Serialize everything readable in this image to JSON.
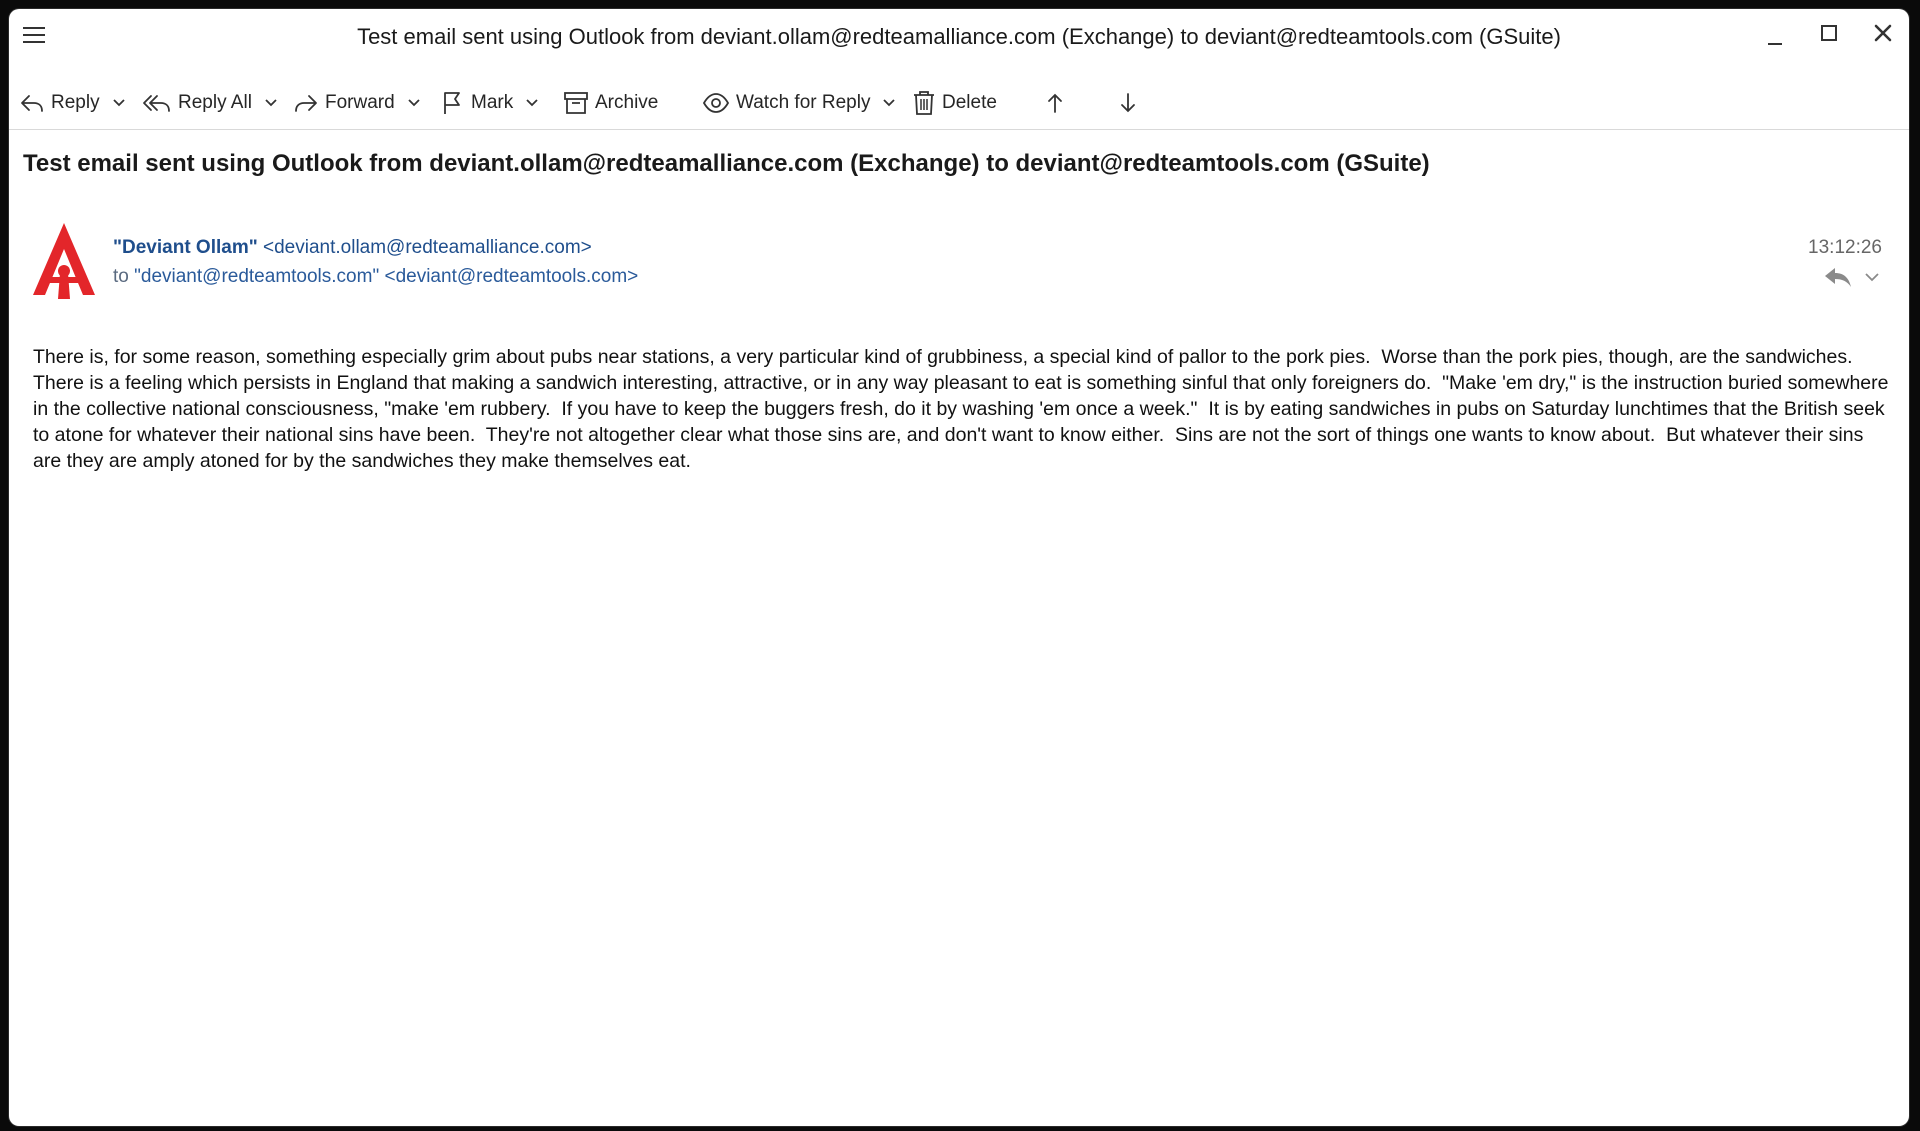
{
  "window": {
    "title": "Test email sent using Outlook from deviant.ollam@redteamalliance.com (Exchange) to deviant@redteamtools.com (GSuite)",
    "controls": [
      "minimize-icon",
      "maximize-icon",
      "close-icon"
    ]
  },
  "toolbar": {
    "reply": "Reply",
    "reply_all": "Reply All",
    "forward": "Forward",
    "mark": "Mark",
    "archive": "Archive",
    "watch": "Watch for Reply",
    "delete": "Delete"
  },
  "message": {
    "subject": "Test email sent using Outlook from deviant.ollam@redteamalliance.com (Exchange) to deviant@redteamtools.com (GSuite)",
    "from_name": "\"Deviant Ollam\"",
    "from_addr": "<deviant.ollam@redteamalliance.com>",
    "to_prefix": "to",
    "to_name": "\"deviant@redteamtools.com\"",
    "to_addr": "<deviant@redteamtools.com>",
    "time": "13:12:26",
    "body": "There is, for some reason, something especially grim about pubs near stations, a very particular kind of grubbiness, a special kind of pallor to the pork pies.  Worse than the pork pies, though, are the sandwiches.  There is a feeling which persists in England that making a sandwich interesting, attractive, or in any way pleasant to eat is something sinful that only foreigners do.  \"Make 'em dry,\" is the instruction buried somewhere in the collective national consciousness, \"make 'em rubbery.  If you have to keep the buggers fresh, do it by washing 'em once a week.\"  It is by eating sandwiches in pubs on Saturday lunchtimes that the British seek to atone for whatever their national sins have been.  They're not altogether clear what those sins are, and don't want to know either.  Sins are not the sort of things one wants to know about.  But whatever their sins are they are amply atoned for by the sandwiches they make themselves eat."
  },
  "colors": {
    "accent": "#1f4e8c",
    "avatar_red": "#e3262a"
  }
}
